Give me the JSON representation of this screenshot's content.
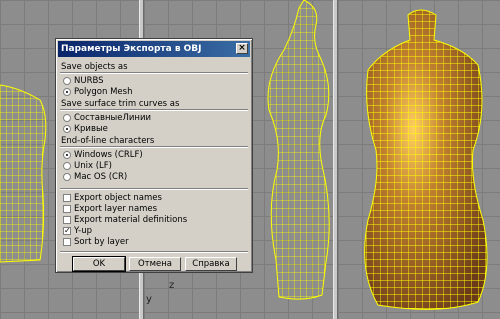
{
  "dialog": {
    "title": "Параметры Экспорта в OBJ",
    "close_glyph": "×",
    "sections": {
      "save_objects": {
        "label": "Save objects as",
        "options": [
          "NURBS",
          "Polygon Mesh"
        ],
        "selected": "Polygon Mesh"
      },
      "trim_curves": {
        "label": "Save surface trim curves as",
        "options": [
          "СоставныеЛинии",
          "Кривые"
        ],
        "selected": "Кривые"
      },
      "eol": {
        "label": "End-of-line characters",
        "options": [
          "Windows (CRLF)",
          "Unix (LF)",
          "Mac OS (CR)"
        ],
        "selected": "Windows (CRLF)"
      },
      "export_flags": [
        {
          "label": "Export object names",
          "checked": false
        },
        {
          "label": "Export layer names",
          "checked": false
        },
        {
          "label": "Export material definitions",
          "checked": false
        },
        {
          "label": "Y-up",
          "checked": true
        },
        {
          "label": "Sort by layer",
          "checked": false
        }
      ]
    },
    "buttons": {
      "ok": "OK",
      "cancel": "Отмена",
      "help": "Справка"
    }
  },
  "viewport": {
    "axis_y": "y",
    "axis_z": "z",
    "colors": {
      "wire": "#ffff00",
      "body": "#8a5a28",
      "bg": "#8d8d8d"
    }
  }
}
